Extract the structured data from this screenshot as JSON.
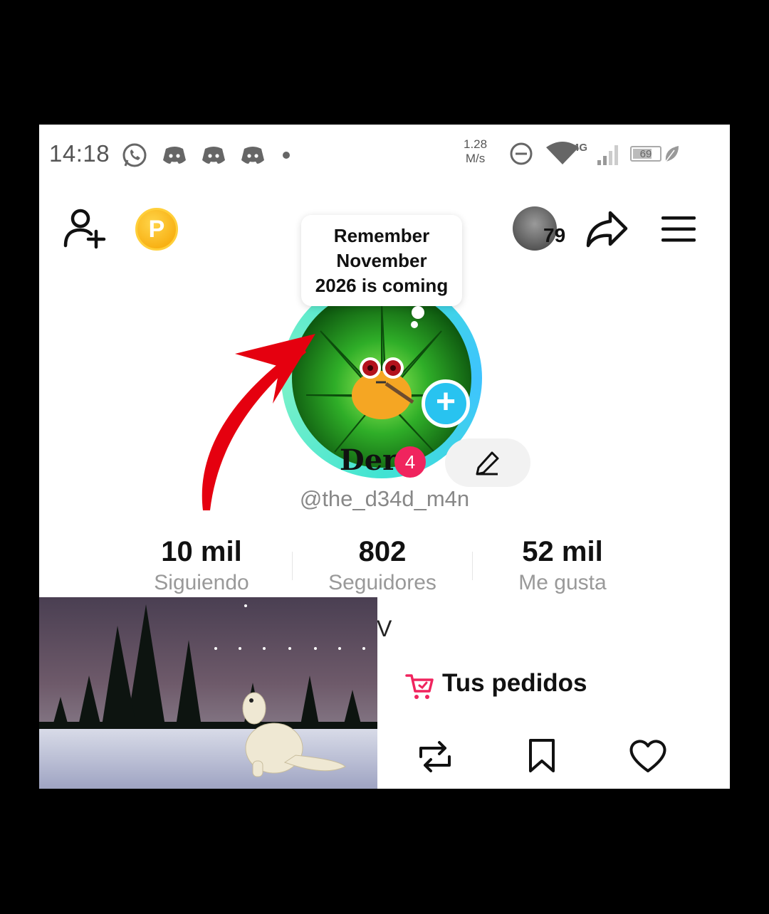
{
  "status_bar": {
    "time": "14:18",
    "net_speed_value": "1.28",
    "net_speed_unit": "M/s",
    "network_type": "4G",
    "battery": "69",
    "icons": [
      "whatsapp-icon",
      "discord-icon",
      "discord-icon",
      "discord-icon",
      "dot-icon",
      "dnd-icon",
      "wifi-icon",
      "signal-icon",
      "battery-icon",
      "leaf-icon"
    ]
  },
  "topbar": {
    "coin_letter": "P",
    "friends_count": "79"
  },
  "bubble": {
    "line1": "Remember",
    "line2": "November",
    "line3": "2026 is coming"
  },
  "profile": {
    "name": "Der",
    "badge_count": "4",
    "handle": "@the_d34d_m4n"
  },
  "stats": [
    {
      "value": "10 mil",
      "label": "Siguiendo"
    },
    {
      "value": "802",
      "label": "Seguidores"
    },
    {
      "value": "52 mil",
      "label": "Me gusta"
    }
  ],
  "bio_fragment": "V",
  "orders_label": "Tus pedidos",
  "colors": {
    "accent_pink": "#f0245e",
    "add_blue": "#28c3f0",
    "ring_cyan": "#41e3d2",
    "arrow_red": "#e5000f"
  }
}
